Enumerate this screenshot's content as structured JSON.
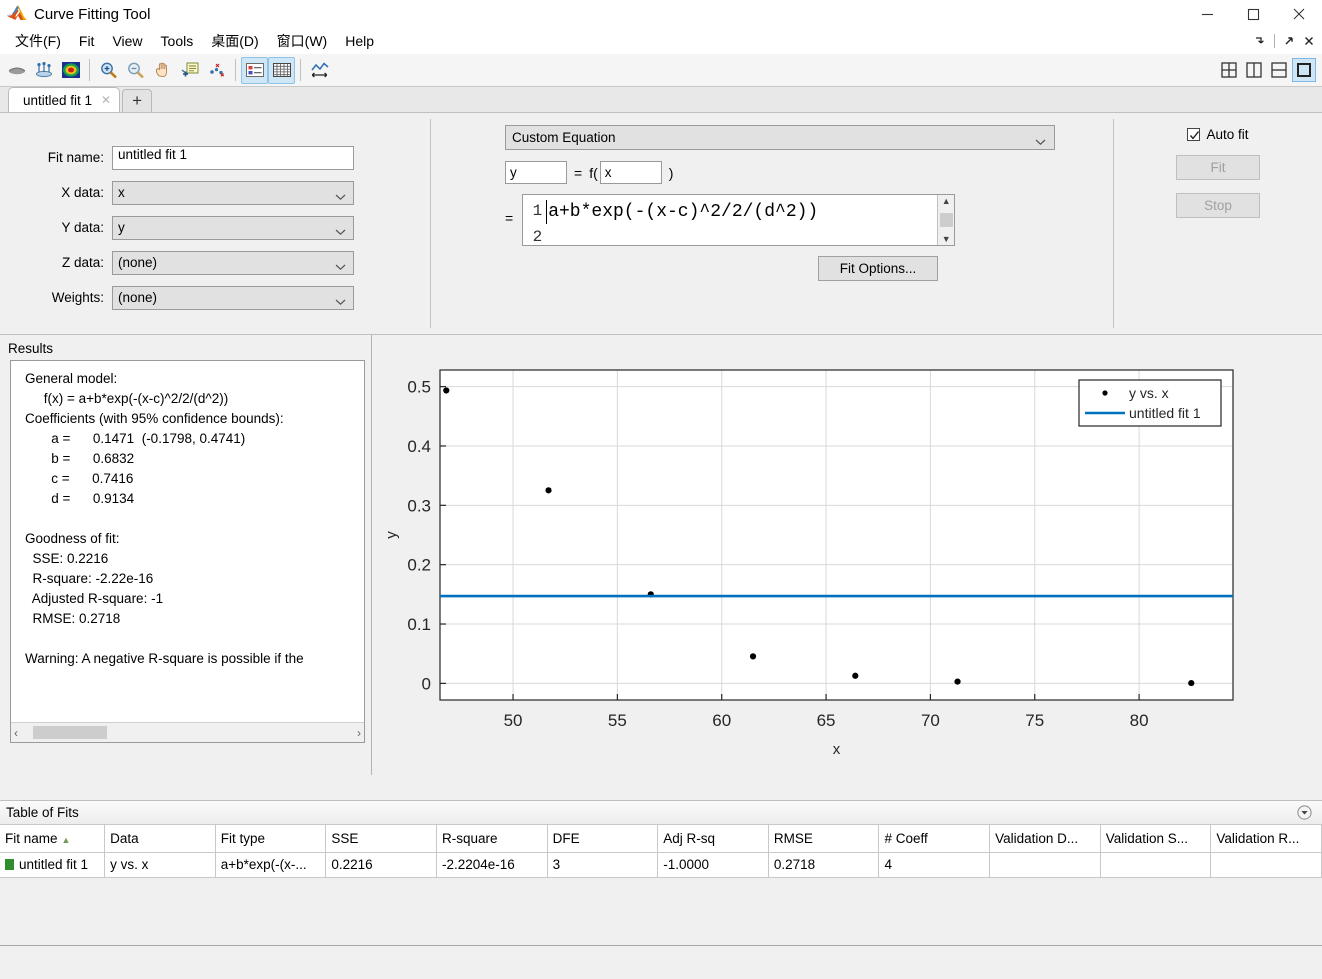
{
  "window": {
    "title": "Curve Fitting Tool",
    "icon": "matlab-logo-icon",
    "minimize": "minimize-icon",
    "maximize": "maximize-icon",
    "close": "close-icon"
  },
  "menu": {
    "items": [
      {
        "label": "文件(F)",
        "name": "menu-file"
      },
      {
        "label": "Fit",
        "name": "menu-fit"
      },
      {
        "label": "View",
        "name": "menu-view"
      },
      {
        "label": "Tools",
        "name": "menu-tools"
      },
      {
        "label": "桌面(D)",
        "name": "menu-desktop"
      },
      {
        "label": "窗口(W)",
        "name": "menu-window"
      },
      {
        "label": "Help",
        "name": "menu-help"
      }
    ],
    "dock_icons": [
      "dock-arrow-icon",
      "undock-arrow-icon",
      "close-panel-icon"
    ]
  },
  "toolbar": {
    "icons": [
      "rotate-3d-icon",
      "data-cursor-icon",
      "colormap-surface-icon",
      "zoom-in-icon",
      "zoom-out-icon",
      "pan-icon",
      "exclude-outliers-icon",
      "exclude-points-icon",
      "legend-toggle-icon",
      "grid-toggle-icon",
      "axes-limits-icon"
    ],
    "active_icons": [
      "legend-toggle-icon",
      "grid-toggle-icon"
    ],
    "layout_icons": [
      "layout-quad-icon",
      "layout-vertical-icon",
      "layout-horizontal-icon",
      "layout-single-icon"
    ],
    "layout_active": "layout-single-icon"
  },
  "tabs": {
    "items": [
      {
        "label": "untitled fit 1",
        "close": "✕"
      }
    ],
    "add_label": "+"
  },
  "fit_config": {
    "fields": [
      {
        "label": "Fit name:",
        "value": "untitled fit 1",
        "type": "input",
        "name": "fit-name-input"
      },
      {
        "label": "X data:",
        "value": "x",
        "type": "select",
        "name": "x-data-select"
      },
      {
        "label": "Y data:",
        "value": "y",
        "type": "select",
        "name": "y-data-select"
      },
      {
        "label": "Z data:",
        "value": "(none)",
        "type": "select",
        "name": "z-data-select"
      },
      {
        "label": "Weights:",
        "value": "(none)",
        "type": "select",
        "name": "weights-select"
      }
    ],
    "fit_type": "Custom Equation",
    "dependent_var": "y",
    "independent_var": "x",
    "equals_sign": "=",
    "f_open": "f(",
    "f_close": ")",
    "eq_equals": "=",
    "equation_line_number": "1",
    "equation_line_number_2": "2",
    "equation": "a+b*exp(-(x-c)^2/2/(d^2))",
    "fit_options_label": "Fit Options...",
    "auto_fit_label": "Auto fit",
    "auto_fit_checked": true,
    "fit_button": "Fit",
    "stop_button": "Stop"
  },
  "results": {
    "title": "Results",
    "lines": [
      "General model:",
      "     f(x) = a+b*exp(-(x-c)^2/2/(d^2))",
      "Coefficients (with 95% confidence bounds):",
      "       a =      0.1471  (-0.1798, 0.4741)",
      "       b =      0.6832",
      "       c =      0.7416",
      "       d =      0.9134",
      "",
      "Goodness of fit:",
      "  SSE: 0.2216",
      "  R-square: -2.22e-16",
      "  Adjusted R-square: -1",
      "  RMSE: 0.2718",
      "",
      "Warning: A negative R-square is possible if the"
    ],
    "scroll_left_arrow": "‹",
    "scroll_right_arrow": "›"
  },
  "chart_data": {
    "type": "scatter",
    "title": "",
    "xlabel": "x",
    "ylabel": "y",
    "xlim": [
      46.5,
      84.5
    ],
    "ylim": [
      -0.028,
      0.528
    ],
    "xticks": [
      50,
      55,
      60,
      65,
      70,
      75,
      80
    ],
    "yticks": [
      0,
      0.1,
      0.2,
      0.3,
      0.4,
      0.5
    ],
    "grid": true,
    "legend_position": "top-right",
    "series": [
      {
        "name": "y vs. x",
        "type": "scatter",
        "marker": "circle",
        "color": "#000000",
        "x": [
          46.8,
          51.7,
          56.6,
          61.5,
          66.4,
          71.3,
          82.5
        ],
        "y": [
          0.4935,
          0.3252,
          0.15,
          0.0455,
          0.0128,
          0.003,
          0.0005
        ]
      },
      {
        "name": "untitled fit 1",
        "type": "line",
        "color": "#0072BD",
        "constant_y": 0.1471,
        "x": [
          46.5,
          84.5
        ],
        "y": [
          0.1471,
          0.1471
        ]
      }
    ]
  },
  "table_of_fits": {
    "title": "Table of Fits",
    "collapse_icon": "collapse-icon",
    "columns": [
      "Fit name",
      "Data",
      "Fit type",
      "SSE",
      "R-square",
      "DFE",
      "Adj R-sq",
      "RMSE",
      "# Coeff",
      "Validation D...",
      "Validation S...",
      "Validation R..."
    ],
    "sort_column": "Fit name",
    "sort_caret": "▲",
    "rows": [
      {
        "fit_name": "untitled fit 1",
        "data": "y vs. x",
        "fit_type": "a+b*exp(-(x-...",
        "sse": "0.2216",
        "r_square": "-2.2204e-16",
        "dfe": "3",
        "adj_r_sq": "-1.0000",
        "rmse": "0.2718",
        "num_coeff": "4",
        "validation_d": "",
        "validation_s": "",
        "validation_r": ""
      }
    ]
  },
  "colors": {
    "fit_line": "#0072BD",
    "data_marker": "#000000",
    "window_bg": "#f0f0f0",
    "plot_bg": "#ffffff"
  }
}
